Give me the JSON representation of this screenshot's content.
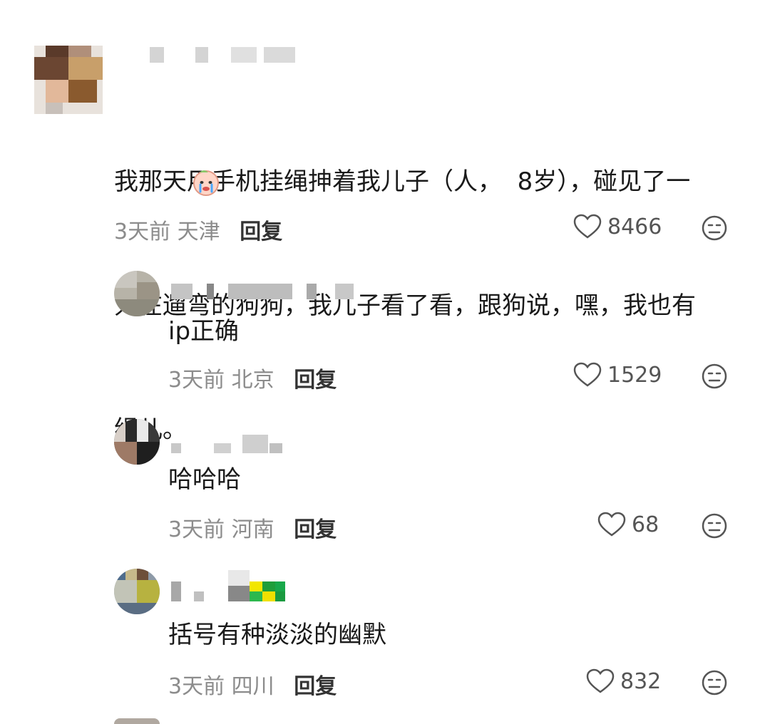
{
  "comments": [
    {
      "text": "我那天用手机挂绳抻着我儿子（人，8岁），碰见了一只在遛弯的狗狗，我儿子看了看，跟狗说，嘿，我也有绳儿。",
      "line1": "我那天用手机挂绳抻着我儿子（人，  8岁），碰见了一",
      "line2": "只在遛弯的狗狗，我儿子看了看，跟狗说，嘿，我也有",
      "line3": "绳儿。",
      "sticker_icon": "crying-face-sticker",
      "time": "3天前",
      "location": "天津",
      "reply": "回复",
      "likes": "8466"
    },
    {
      "text": "ip正确",
      "time": "3天前",
      "location": "北京",
      "reply": "回复",
      "likes": "1529"
    },
    {
      "text": "哈哈哈",
      "time": "3天前",
      "location": "河南",
      "reply": "回复",
      "likes": "68"
    },
    {
      "text": "括号有种淡淡的幽默",
      "time": "3天前",
      "location": "四川",
      "reply": "回复",
      "likes": "832"
    }
  ],
  "icons": {
    "like": "heart-outline-icon",
    "dislike": "meh-face-icon"
  },
  "colors": {
    "meta": "#8c8c8c",
    "text": "#1a1a1a",
    "icon": "#555555"
  }
}
